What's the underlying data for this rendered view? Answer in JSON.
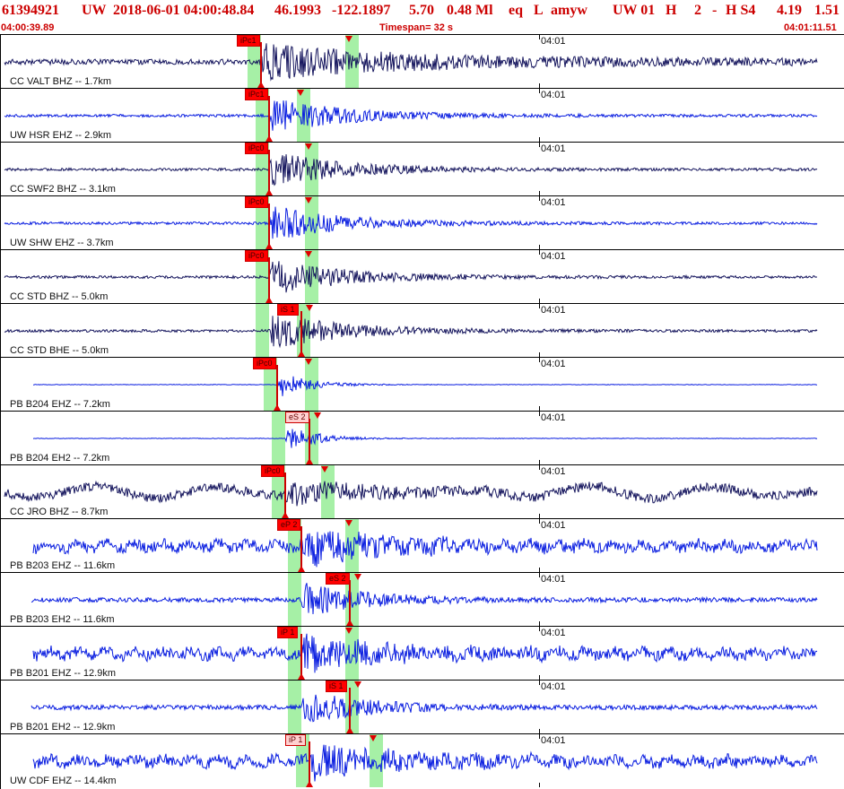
{
  "header": {
    "event_id": "61394921",
    "network": "UW",
    "origin_time": "2018-06-01 04:00:48.84",
    "lat": "46.1993",
    "lon": "-122.1897",
    "depth": "5.70",
    "magnitude": "0.48 Ml",
    "event_type": "eq",
    "location_type": "L",
    "author": "amyw",
    "source": "UW 01",
    "quality": "H",
    "version": "2",
    "dash": "-",
    "method": "H S4",
    "value_a": "4.19",
    "value_b": "1.51"
  },
  "subheader": {
    "start_time": "04:00:39.89",
    "timespan": "Timespan=  32 s",
    "end_time": "04:01:11.51"
  },
  "tick_time_label": "04:01",
  "colors": {
    "header_text": "#cc0000",
    "trace_navy": "#16165e",
    "trace_blue": "#0a1ee0",
    "pick_red": "#cc0000",
    "window_green": "#a6f0a6"
  },
  "traces": [
    {
      "label": "CC VALT BHZ -- 1.7km",
      "color": "navy",
      "style": "hf",
      "onset": 0.32,
      "s_onset": 0.43,
      "pick": "iPc1",
      "pick_kind": "solid"
    },
    {
      "label": "UW HSR EHZ -- 2.9km",
      "color": "blue",
      "style": "burst",
      "onset": 0.33,
      "s_onset": 0.37,
      "pick": "iPc1",
      "pick_kind": "solid"
    },
    {
      "label": "CC SWF2 BHZ -- 3.1km",
      "color": "navy",
      "style": "burst",
      "onset": 0.33,
      "s_onset": 0.38,
      "pick": "iPc0",
      "pick_kind": "solid"
    },
    {
      "label": "UW SHW EHZ -- 3.7km",
      "color": "blue",
      "style": "burst",
      "onset": 0.33,
      "s_onset": 0.38,
      "pick": "iPc0",
      "pick_kind": "solid"
    },
    {
      "label": "CC STD BHZ -- 5.0km",
      "color": "navy",
      "style": "burst",
      "onset": 0.33,
      "s_onset": 0.38,
      "pick": "iPc0",
      "pick_kind": "solid"
    },
    {
      "label": "CC STD BHE -- 5.0km",
      "color": "navy",
      "style": "burst",
      "onset": 0.33,
      "s_onset": 0.37,
      "pick": "iS 1",
      "pick_kind": "solid"
    },
    {
      "label": "PB B204 EHZ -- 7.2km",
      "color": "blue",
      "style": "quiet",
      "onset": 0.34,
      "s_onset": 0.38,
      "pick": "iPc0",
      "pick_kind": "solid"
    },
    {
      "label": "PB B204 EH2 -- 7.2km",
      "color": "blue",
      "style": "quiet",
      "onset": 0.35,
      "s_onset": 0.38,
      "pick": "eS 2",
      "pick_kind": "pale"
    },
    {
      "label": "CC JRO BHZ -- 8.7km",
      "color": "navy",
      "style": "swell",
      "onset": 0.35,
      "s_onset": 0.4,
      "pick": "iPc0",
      "pick_kind": "solid"
    },
    {
      "label": "PB B203 EHZ -- 11.6km",
      "color": "blue",
      "style": "noisy",
      "onset": 0.37,
      "s_onset": 0.43,
      "pick": "eP 2",
      "pick_kind": "solid"
    },
    {
      "label": "PB B203 EH2 -- 11.6km",
      "color": "blue",
      "style": "medium",
      "onset": 0.37,
      "s_onset": 0.43,
      "pick": "eS 2",
      "pick_kind": "solid"
    },
    {
      "label": "PB B201 EHZ -- 12.9km",
      "color": "blue",
      "style": "noisy",
      "onset": 0.37,
      "s_onset": 0.43,
      "pick": "iP 1",
      "pick_kind": "solid"
    },
    {
      "label": "PB B201 EH2 -- 12.9km",
      "color": "blue",
      "style": "medium",
      "onset": 0.37,
      "s_onset": 0.43,
      "pick": "iS 1",
      "pick_kind": "solid"
    },
    {
      "label": "UW CDF EHZ -- 14.4km",
      "color": "blue",
      "style": "noisy",
      "onset": 0.38,
      "s_onset": 0.46,
      "pick": "iP 1",
      "pick_kind": "pale"
    }
  ]
}
